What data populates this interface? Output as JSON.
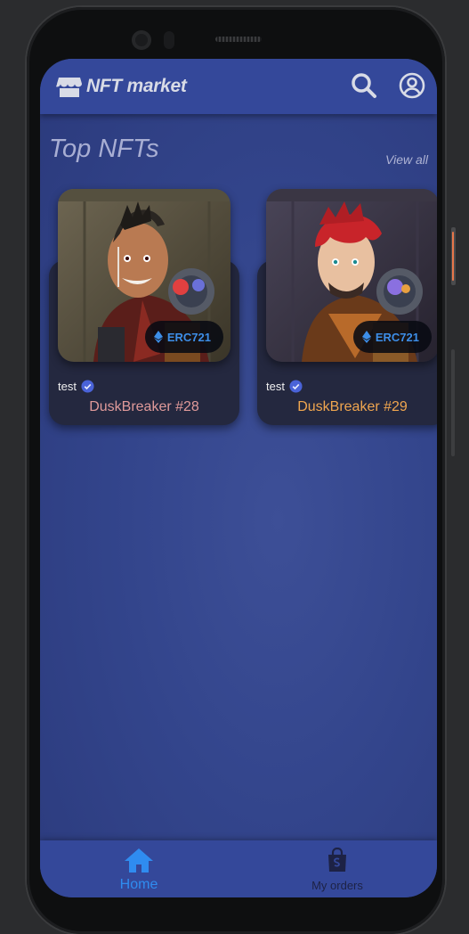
{
  "appbar": {
    "title": "NFT market",
    "icons": {
      "brand": "storefront-icon",
      "search": "search-icon",
      "account": "account-circle-icon"
    }
  },
  "section": {
    "title": "Top NFTs",
    "view_all": "View all"
  },
  "cards": [
    {
      "owner": "test",
      "name": "DuskBreaker #28",
      "standard": "ERC721",
      "name_color": "#e09a9a",
      "art": "mohawk-warrior"
    },
    {
      "owner": "test",
      "name": "DuskBreaker #29",
      "standard": "ERC721",
      "name_color": "#f0a64f",
      "art": "red-hair-warrior"
    }
  ],
  "bottom_nav": {
    "items": [
      {
        "label": "Home",
        "icon": "home-icon",
        "active": true,
        "color": "#2f8cf0"
      },
      {
        "label": "My orders",
        "icon": "shopping-bag-icon",
        "active": false,
        "color": "#1d2245"
      }
    ]
  },
  "colors": {
    "accent": "#2f8cf0",
    "appbar": "#34489a",
    "background": "#33458c",
    "card": "#24283f"
  }
}
